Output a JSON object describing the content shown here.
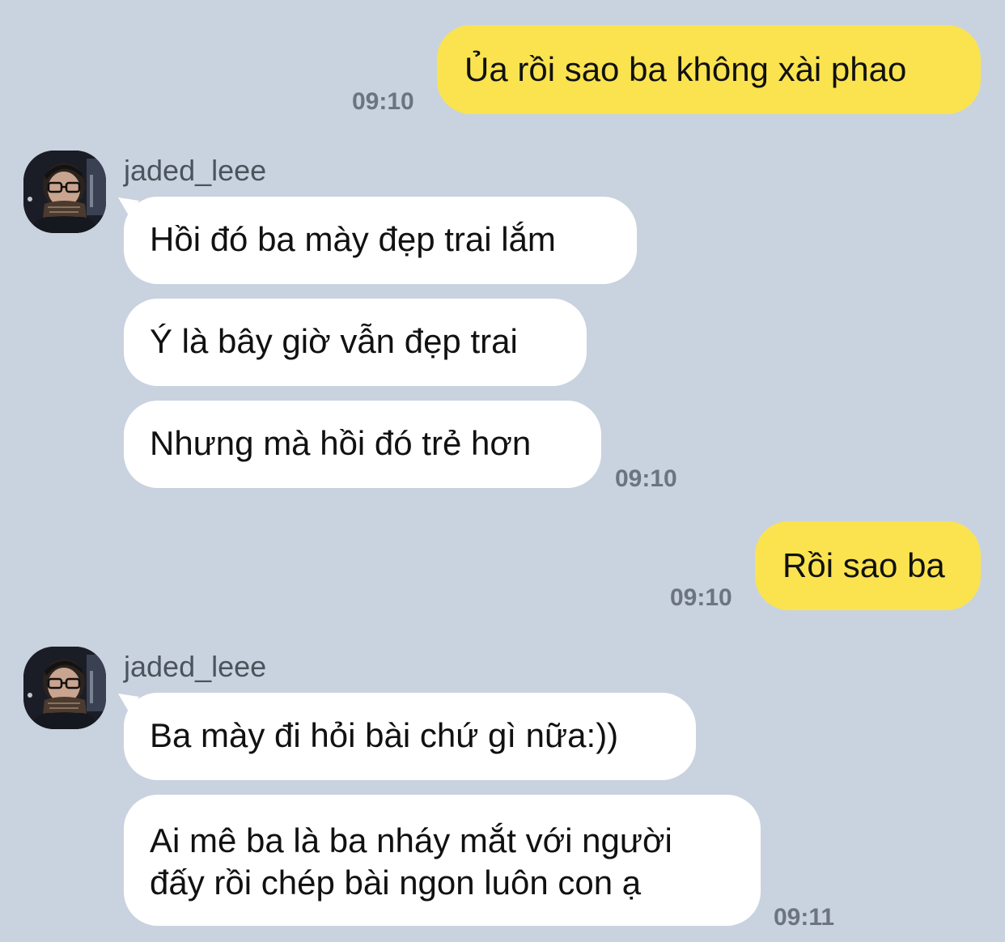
{
  "colors": {
    "background": "#c9d3df",
    "outgoing_bubble": "#fae34f",
    "incoming_bubble": "#ffffff",
    "timestamp": "#6b7480"
  },
  "messages": [
    {
      "direction": "outgoing",
      "text": "Ủa rồi sao ba không xài phao",
      "time": "09:10"
    },
    {
      "direction": "incoming",
      "sender": "jaded_leee",
      "lines": [
        "Hồi đó ba mày đẹp trai lắm",
        "Ý là bây giờ vẫn đẹp trai",
        "Nhưng mà hồi đó trẻ hơn"
      ],
      "time": "09:10"
    },
    {
      "direction": "outgoing",
      "text": "Rồi sao ba",
      "time": "09:10"
    },
    {
      "direction": "incoming",
      "sender": "jaded_leee",
      "lines": [
        "Ba mày đi hỏi bài chứ gì nữa:))",
        "Ai mê ba là ba nháy mắt với người",
        "đấy rồi chép bài ngon luôn con ạ"
      ],
      "time": "09:11"
    }
  ]
}
